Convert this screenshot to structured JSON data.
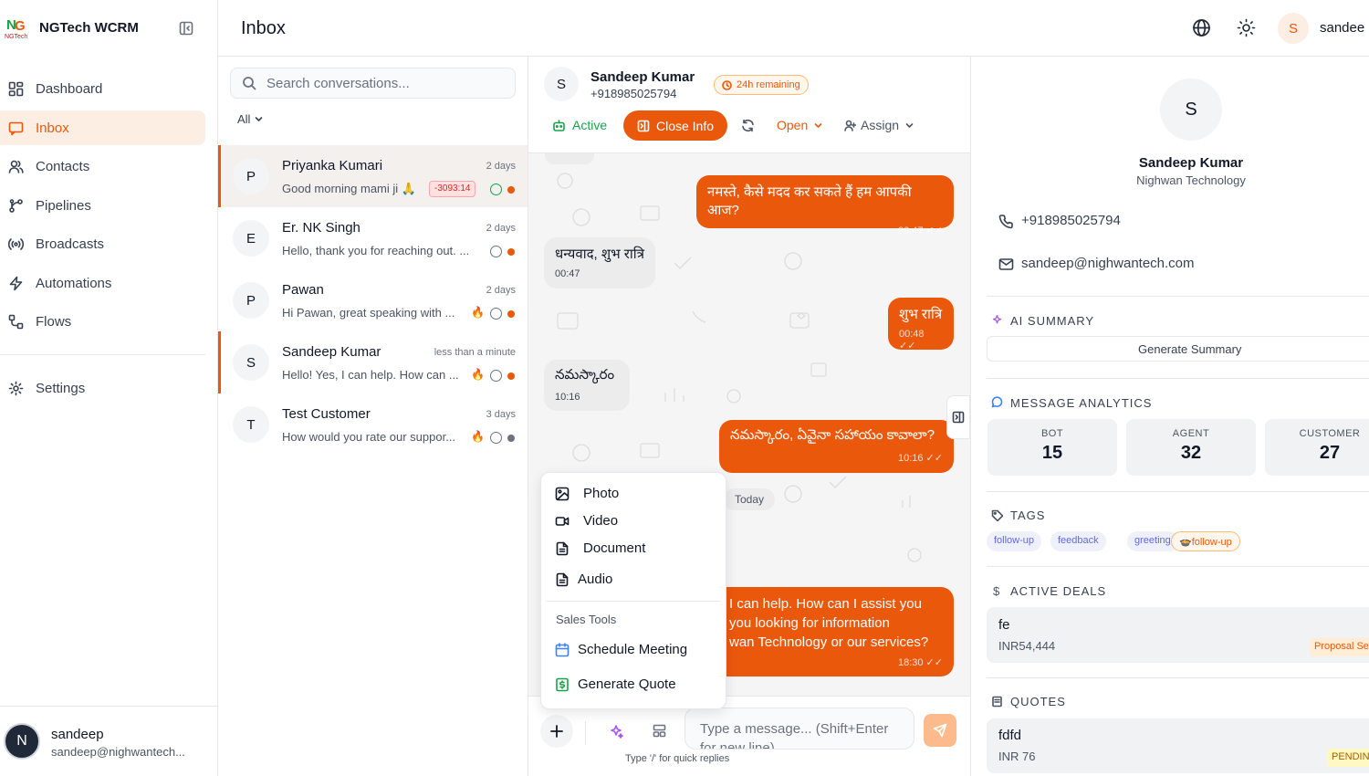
{
  "brand": {
    "name": "NGTech WCRM",
    "logo_text": "NGTech"
  },
  "nav": {
    "items": [
      {
        "label": "Dashboard",
        "icon": "dashboard-icon"
      },
      {
        "label": "Inbox",
        "icon": "inbox-icon",
        "active": true
      },
      {
        "label": "Contacts",
        "icon": "contacts-icon"
      },
      {
        "label": "Pipelines",
        "icon": "pipelines-icon"
      },
      {
        "label": "Broadcasts",
        "icon": "broadcast-icon"
      },
      {
        "label": "Automations",
        "icon": "automation-icon"
      },
      {
        "label": "Flows",
        "icon": "flows-icon"
      }
    ],
    "settings": "Settings",
    "user": {
      "initial": "N",
      "name": "sandeep",
      "email": "sandeep@nighwantech..."
    }
  },
  "header": {
    "title": "Inbox",
    "user_initial": "S",
    "user_name": "sandee"
  },
  "conversations": {
    "search_placeholder": "Search conversations...",
    "filter": "All",
    "items": [
      {
        "initial": "P",
        "name": "Priyanka Kumari",
        "time": "2 days",
        "preview": "Good morning mami ji 🙏",
        "badge": "-3093:14",
        "dot": "#ea580c"
      },
      {
        "initial": "E",
        "name": "Er. NK Singh",
        "time": "2 days",
        "preview": "Hello, thank you for reaching out. ...",
        "dot": "#ea580c"
      },
      {
        "initial": "P",
        "name": "Pawan",
        "time": "2 days",
        "preview": "Hi Pawan, great speaking with ...",
        "dot": "#ea580c"
      },
      {
        "initial": "S",
        "name": "Sandeep Kumar",
        "time": "less than a minute",
        "preview": "Hello! Yes, I can help. How can ...",
        "dot": "#ea580c"
      },
      {
        "initial": "T",
        "name": "Test Customer",
        "time": "3 days",
        "preview": "How would you rate our suppor...",
        "dot": "#6b7280"
      }
    ]
  },
  "chat": {
    "contact": {
      "initial": "S",
      "name": "Sandeep Kumar",
      "phone": "+918985025794",
      "window": "24h remaining"
    },
    "toolbar": {
      "active": "Active",
      "close_info": "Close Info",
      "status": "Open",
      "assign": "Assign"
    },
    "messages": [
      {
        "dir": "out",
        "text": "नमस्ते, कैसे मदद कर सकते हैं हम आपकी आज?",
        "time": "00:47"
      },
      {
        "dir": "in",
        "text": "धन्यवाद, शुभ रात्रि",
        "time": "00:47"
      },
      {
        "dir": "out",
        "text": "शुभ रात्रि",
        "time": "00:48"
      },
      {
        "dir": "in",
        "text": "నమస్కారం",
        "time": "10:16"
      },
      {
        "dir": "out",
        "text": "నమస్కారం, ఏవైనా సహాయం కావాలా?",
        "time": "10:16"
      },
      {
        "dir": "out",
        "line1": "I can help. How can I assist you",
        "line2": "you looking for information",
        "line3": "wan Technology or our services?",
        "time": "18:30"
      }
    ],
    "day_label": "Today",
    "composer_placeholder": "Type a message... (Shift+Enter for new line)",
    "hint": "Type '/' for quick replies"
  },
  "attach_menu": {
    "items": [
      "Photo",
      "Video",
      "Document",
      "Audio"
    ],
    "section": "Sales Tools",
    "tools": [
      "Schedule Meeting",
      "Generate Quote"
    ]
  },
  "info": {
    "initial": "S",
    "name": "Sandeep Kumar",
    "company": "Nighwan Technology",
    "phone": "+918985025794",
    "email": "sandeep@nighwantech.com",
    "ai_summary_title": "AI SUMMARY",
    "generate_summary": "Generate Summary",
    "analytics_title": "MESSAGE ANALYTICS",
    "stats": [
      {
        "label": "BOT",
        "value": "15"
      },
      {
        "label": "AGENT",
        "value": "32"
      },
      {
        "label": "CUSTOMER",
        "value": "27"
      }
    ],
    "tags_title": "TAGS",
    "tags": [
      "follow-up",
      "feedback",
      "greeting",
      "🍲follow-up"
    ],
    "deals_title": "ACTIVE DEALS",
    "deal": {
      "name": "fe",
      "amount": "INR54,444",
      "stage": "Proposal Se"
    },
    "quotes_title": "QUOTES",
    "quote": {
      "name": "fdfd",
      "amount": "INR 76",
      "status": "PENDIN"
    }
  },
  "colors": {
    "accent": "#ea580c",
    "accent_soft": "#fdeee4",
    "tag_bg": "#eef0fb"
  }
}
